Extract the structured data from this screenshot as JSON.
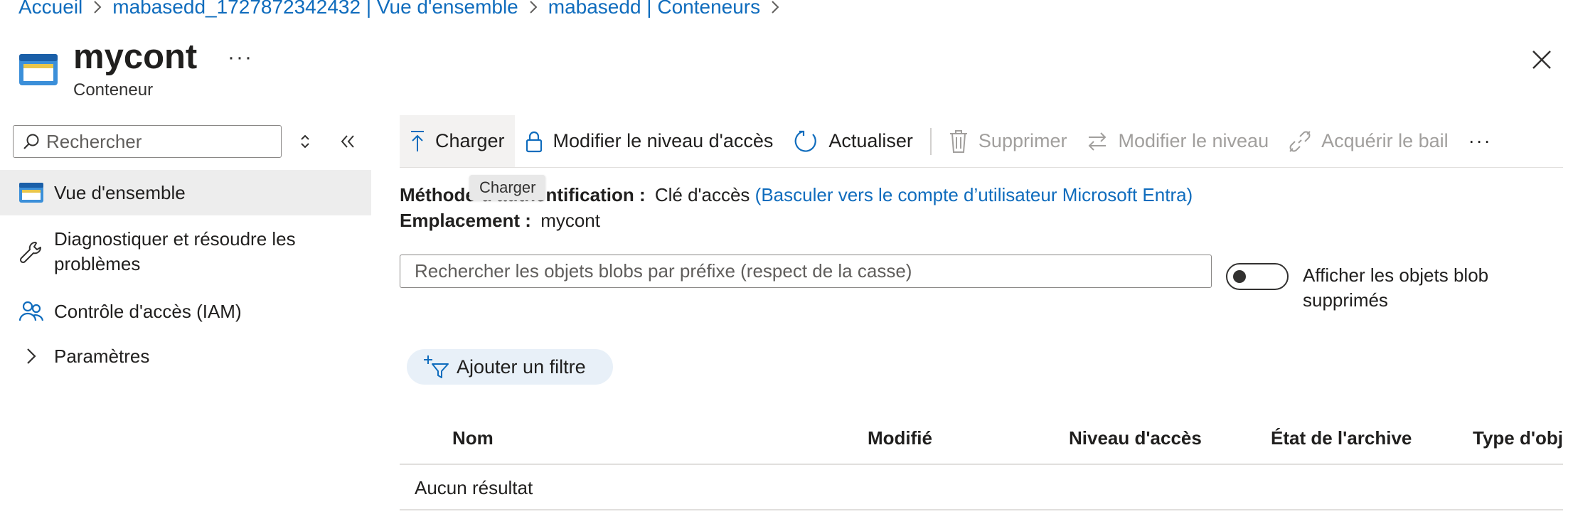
{
  "breadcrumb": [
    "Accueil",
    "mabasedd_1727872342432 | Vue d'ensemble",
    "mabasedd | Conteneurs"
  ],
  "header": {
    "title": "mycont",
    "subtitle": "Conteneur",
    "more": "···"
  },
  "nav": {
    "search_placeholder": "Rechercher",
    "items": [
      {
        "label": "Vue d'ensemble",
        "icon": "container-icon",
        "selected": true
      },
      {
        "label": "Diagnostiquer et résoudre les problèmes",
        "icon": "wrench-icon"
      },
      {
        "label": "Contrôle d'accès (IAM)",
        "icon": "people-icon"
      },
      {
        "label": "Paramètres",
        "icon": "chevron-right-icon"
      }
    ]
  },
  "toolbar": {
    "upload": "Charger",
    "access_level": "Modifier le niveau d'accès",
    "refresh": "Actualiser",
    "delete": "Supprimer",
    "change_tier": "Modifier le niveau",
    "lease": "Acquérir le bail",
    "more": "···"
  },
  "tooltip": "Charger",
  "auth": {
    "label": "Méthode d'authentification :",
    "value": "Clé d'accès",
    "link": "(Basculer vers le compte d’utilisateur Microsoft Entra)"
  },
  "location": {
    "label": "Emplacement :",
    "value": "mycont"
  },
  "blob_search_placeholder": "Rechercher les objets blobs par préfixe (respect de la casse)",
  "deleted_toggle": {
    "label": "Afficher les objets blob supprimés",
    "on": false
  },
  "filter_button": "Ajouter un filtre",
  "table": {
    "columns": [
      "Nom",
      "Modifié",
      "Niveau d'accès",
      "État de l'archive",
      "Type d'objet blob"
    ],
    "empty": "Aucun résultat"
  },
  "colors": {
    "link": "#0f6cbd",
    "selected_bg": "#ededed",
    "pill_bg": "#e8f0f8",
    "icon_blue": "#0f6cbd"
  }
}
